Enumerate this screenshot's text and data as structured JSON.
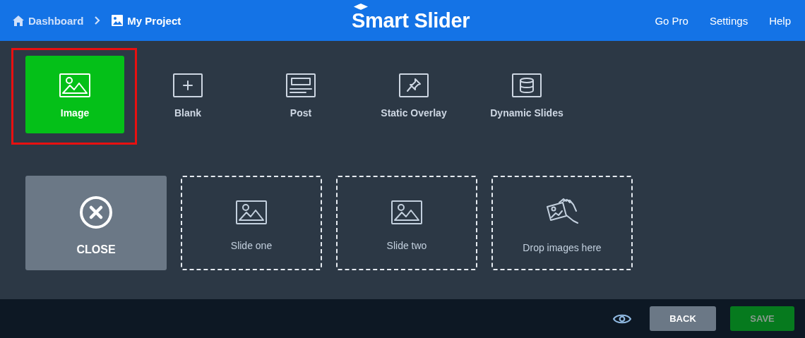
{
  "breadcrumb": [
    {
      "label": "Dashboard",
      "kind": "home"
    },
    {
      "label": "My Project",
      "kind": "project"
    }
  ],
  "logo": {
    "text": "Smart Slider"
  },
  "nav": [
    "Go Pro",
    "Settings",
    "Help"
  ],
  "slide_types": [
    {
      "label": "Image",
      "selected": true,
      "highlighted": true
    },
    {
      "label": "Blank",
      "selected": false,
      "highlighted": false
    },
    {
      "label": "Post",
      "selected": false,
      "highlighted": false
    },
    {
      "label": "Static Overlay",
      "selected": false,
      "highlighted": false
    },
    {
      "label": "Dynamic Slides",
      "selected": false,
      "highlighted": false
    }
  ],
  "slides": [
    {
      "kind": "close",
      "label": "CLOSE"
    },
    {
      "kind": "slide",
      "label": "Slide one"
    },
    {
      "kind": "slide",
      "label": "Slide two"
    },
    {
      "kind": "drop",
      "label": "Drop images here"
    }
  ],
  "footer": {
    "back": {
      "label": "BACK"
    },
    "save": {
      "label": "SAVE",
      "disabled": true
    }
  }
}
